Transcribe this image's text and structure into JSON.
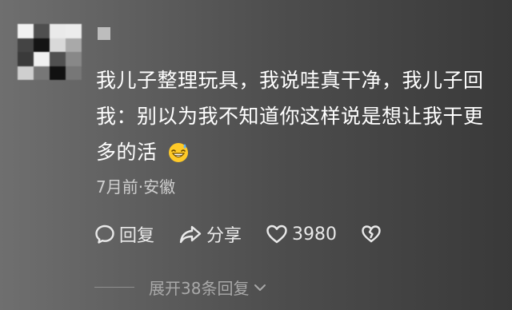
{
  "comment": {
    "text_lines": [
      "我儿子整理玩具，我说哇真干净，我儿子回",
      "我：别以为我不知道你这样说是想让我干更",
      "多的活"
    ],
    "emoji": "grinning-sweat-emoji",
    "meta": "7月前·安徽"
  },
  "actions": {
    "reply_label": "回复",
    "share_label": "分享",
    "like_count": "3980"
  },
  "expand": {
    "label": "展开38条回复"
  },
  "icons": {
    "reply": "comment-bubble-icon",
    "share": "share-arrow-icon",
    "like": "heart-outline-icon",
    "dislike": "broken-heart-icon",
    "expand": "chevron-down-icon"
  }
}
